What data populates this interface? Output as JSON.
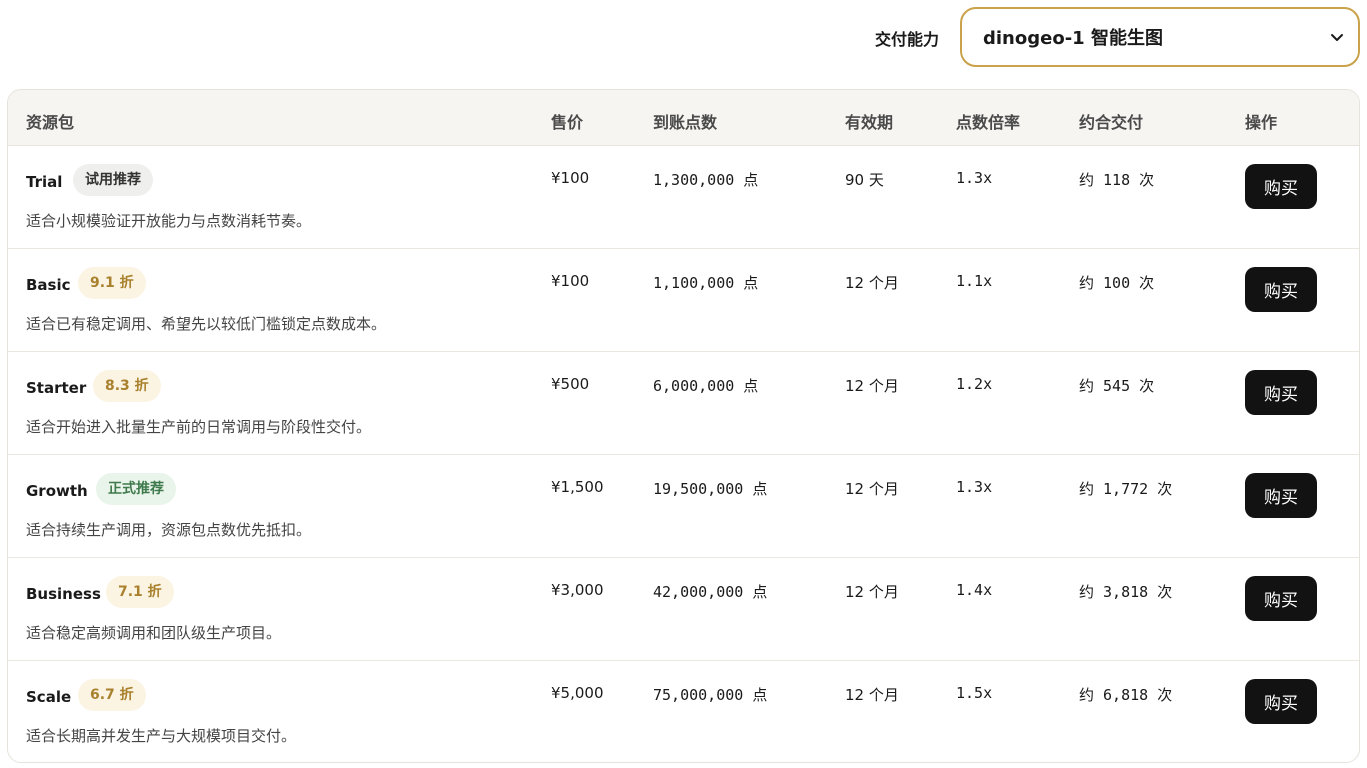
{
  "capability": {
    "label": "交付能力",
    "selected": "dinogeo-1 智能生图"
  },
  "table": {
    "headers": [
      "资源包",
      "售价",
      "到账点数",
      "有效期",
      "点数倍率",
      "约合交付",
      "操作"
    ],
    "rows": [
      {
        "name": "Trial",
        "badge": "试用推荐",
        "badge_style": "gray",
        "desc": "适合小规模验证开放能力与点数消耗节奏。",
        "price": "¥100",
        "points": "1,300,000 点",
        "validity": "90 天",
        "rate": "1.3x",
        "deliver": "约 118 次",
        "action": "购买"
      },
      {
        "name": "Basic",
        "badge": "9.1 折",
        "badge_style": "gold",
        "desc": "适合已有稳定调用、希望先以较低门槛锁定点数成本。",
        "price": "¥100",
        "points": "1,100,000 点",
        "validity": "12 个月",
        "rate": "1.1x",
        "deliver": "约 100 次",
        "action": "购买"
      },
      {
        "name": "Starter",
        "badge": "8.3 折",
        "badge_style": "gold",
        "desc": "适合开始进入批量生产前的日常调用与阶段性交付。",
        "price": "¥500",
        "points": "6,000,000 点",
        "validity": "12 个月",
        "rate": "1.2x",
        "deliver": "约 545 次",
        "action": "购买"
      },
      {
        "name": "Growth",
        "badge": "正式推荐",
        "badge_style": "green",
        "desc": "适合持续生产调用，资源包点数优先抵扣。",
        "price": "¥1,500",
        "points": "19,500,000 点",
        "validity": "12 个月",
        "rate": "1.3x",
        "deliver": "约 1,772 次",
        "action": "购买"
      },
      {
        "name": "Business",
        "badge": "7.1 折",
        "badge_style": "gold",
        "desc": "适合稳定高频调用和团队级生产项目。",
        "price": "¥3,000",
        "points": "42,000,000 点",
        "validity": "12 个月",
        "rate": "1.4x",
        "deliver": "约 3,818 次",
        "action": "购买"
      },
      {
        "name": "Scale",
        "badge": "6.7 折",
        "badge_style": "gold",
        "desc": "适合长期高并发生产与大规模项目交付。",
        "price": "¥5,000",
        "points": "75,000,000 点",
        "validity": "12 个月",
        "rate": "1.5x",
        "deliver": "约 6,818 次",
        "action": "购买"
      }
    ]
  },
  "colors": {
    "accent_border": "#c9a24a",
    "button_bg": "#121212",
    "header_bg": "#f6f5f2"
  }
}
